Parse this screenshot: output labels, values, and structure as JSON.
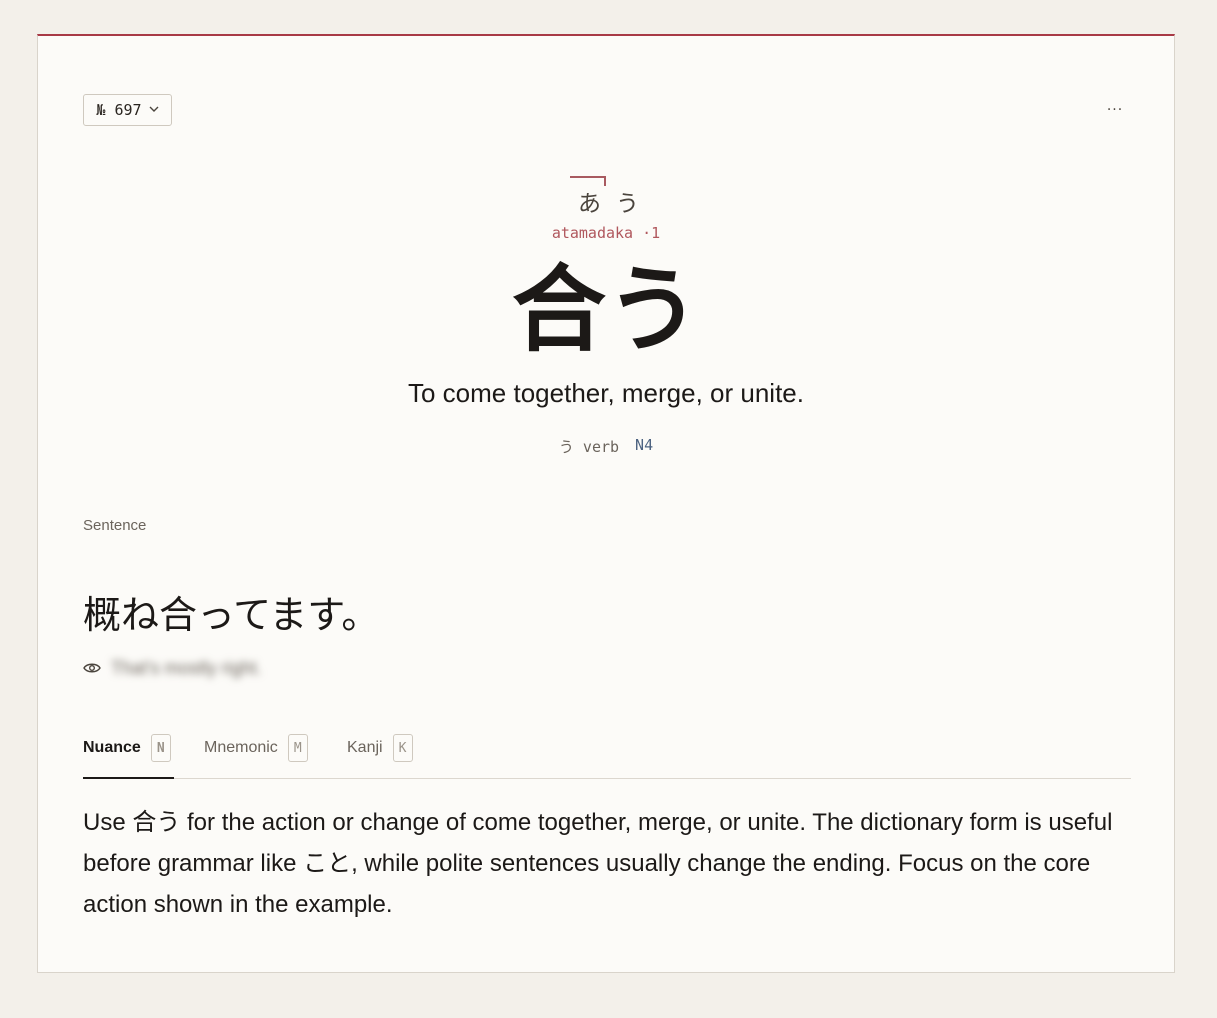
{
  "card": {
    "number_label": "№ 697",
    "more_label": "···"
  },
  "word": {
    "reading_mora": [
      "あ",
      "う"
    ],
    "pitch_label": "atamadaka ·1",
    "headword": "合う",
    "gloss": "To come together, merge, or unite.",
    "tags": {
      "verb_type": "う verb",
      "jlpt": "N4"
    }
  },
  "sentence": {
    "section_label": "Sentence",
    "text": "概ね合ってます。",
    "translation_hidden": "That's mostly right."
  },
  "tabs": [
    {
      "label": "Nuance",
      "key": "N",
      "active": true
    },
    {
      "label": "Mnemonic",
      "key": "M",
      "active": false
    },
    {
      "label": "Kanji",
      "key": "K",
      "active": false
    }
  ],
  "nuance_text": "Use 合う for the action or change of come together, merge, or unite. The dictionary form is useful before grammar like こと, while polite sentences usually change the ending. Focus on the core action shown in the example.",
  "colors": {
    "accent": "#a83a46",
    "pitch": "#b0575d",
    "jlpt": "#4d6381",
    "background": "#f3f0ea",
    "card": "#fcfbf8"
  }
}
